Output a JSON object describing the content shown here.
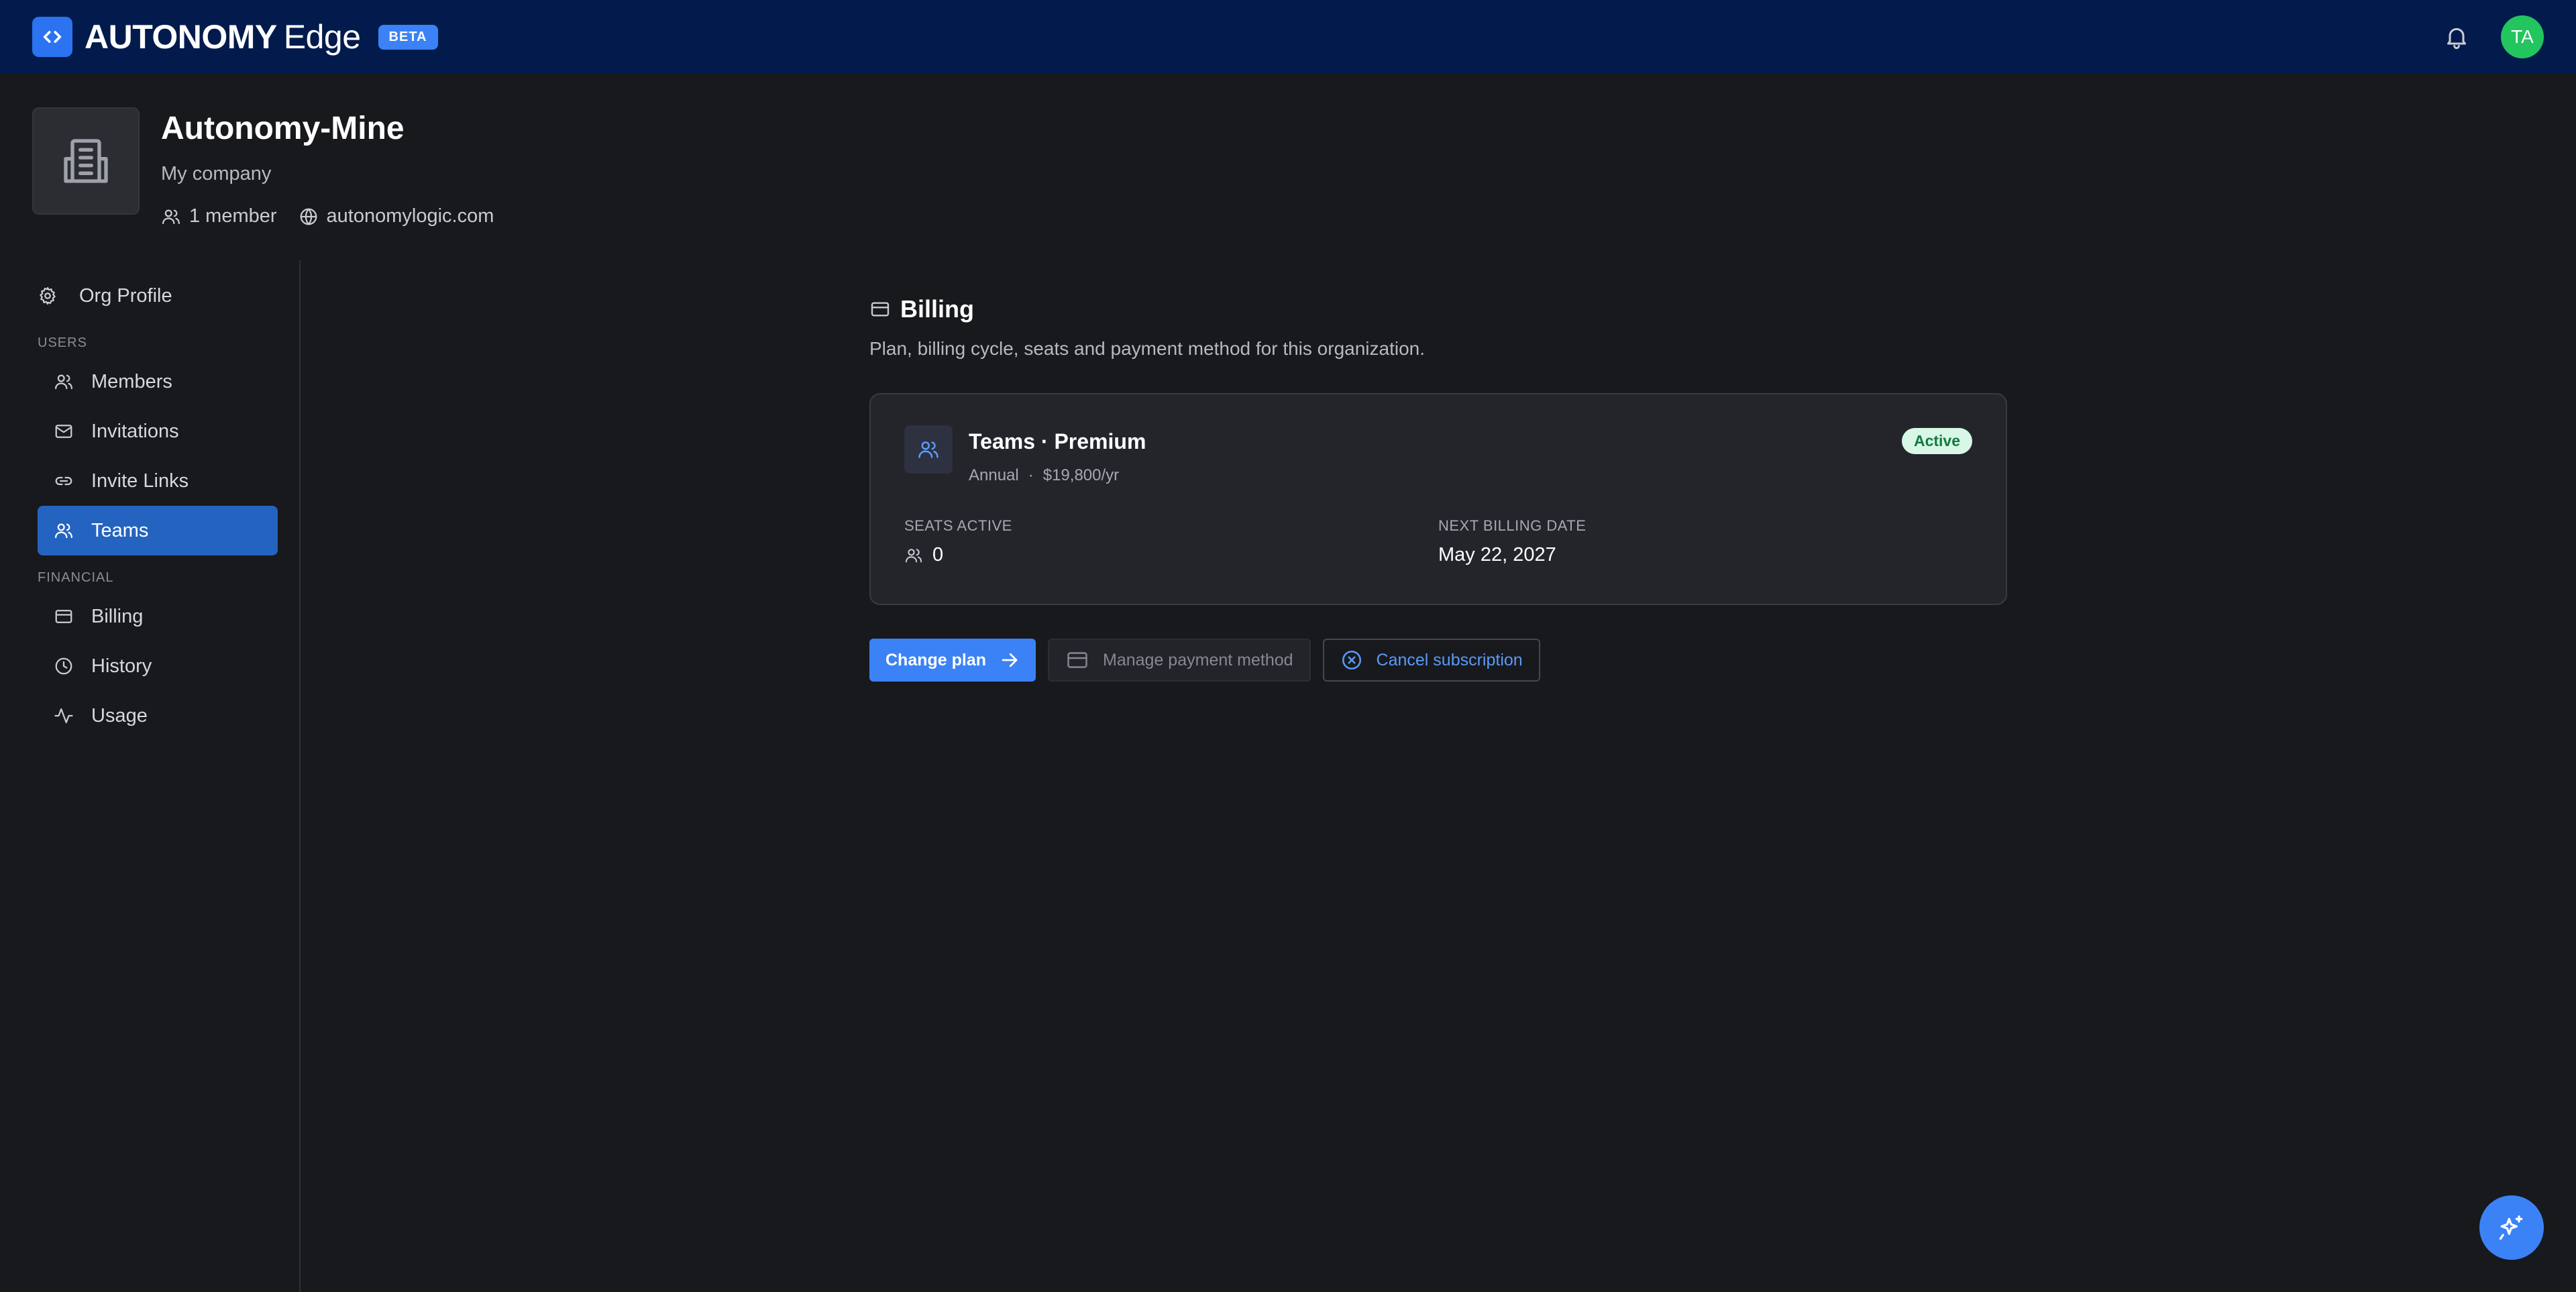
{
  "header": {
    "brand_main": "AUTONOMY",
    "brand_sub": "Edge",
    "beta_label": "BETA",
    "avatar_initials": "TA"
  },
  "org": {
    "name": "Autonomy-Mine",
    "subtitle": "My company",
    "members": "1 member",
    "domain": "autonomylogic.com"
  },
  "sidebar": {
    "org_profile": "Org Profile",
    "sections": [
      {
        "title": "USERS",
        "items": [
          "Members",
          "Invitations",
          "Invite Links",
          "Teams"
        ]
      },
      {
        "title": "FINANCIAL",
        "items": [
          "Billing",
          "History",
          "Usage"
        ]
      }
    ],
    "active_item": "Teams"
  },
  "billing": {
    "title": "Billing",
    "description": "Plan, billing cycle, seats and payment method for this organization.",
    "plan": {
      "name": "Teams · Premium",
      "cycle": "Annual",
      "separator": "·",
      "price": "$19,800/yr",
      "status": "Active"
    },
    "stats": {
      "seats_label": "SEATS ACTIVE",
      "seats_value": "0",
      "next_billing_label": "NEXT BILLING DATE",
      "next_billing_value": "May 22, 2027"
    },
    "actions": {
      "change_plan": "Change plan",
      "manage_payment": "Manage payment method",
      "cancel": "Cancel subscription"
    }
  },
  "colors": {
    "topbar": "#031b4c",
    "background": "#18191d",
    "accent": "#3b82f6",
    "active_nav": "#2563c0",
    "status_active": "#22c55e"
  },
  "icons": {
    "brand": "code-brackets-icon",
    "notifications": "bell-icon",
    "org": "building-icon",
    "members": "users-icon",
    "domain": "globe-icon",
    "org_profile": "gear-icon",
    "invitations": "mail-icon",
    "invite_links": "link-icon",
    "billing": "credit-card-icon",
    "history": "clock-icon",
    "usage": "activity-icon",
    "fab": "sparkles-icon"
  }
}
